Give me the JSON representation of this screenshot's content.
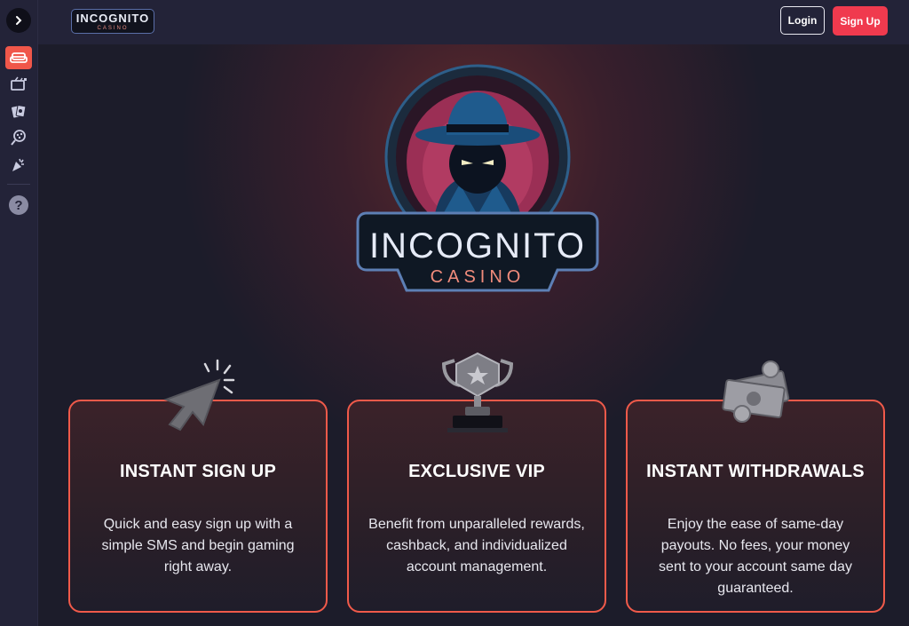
{
  "brand": {
    "logo_word": "INCOGNITO",
    "logo_sub": "CASINO",
    "hero_word": "INCOGNITO",
    "hero_sub": "CASINO"
  },
  "header": {
    "login_label": "Login",
    "signup_label": "Sign Up"
  },
  "sidebar": {
    "toggle_icon": "chevron-right-icon",
    "items": [
      {
        "icon": "sofa-icon",
        "active": true
      },
      {
        "icon": "tv-icon",
        "active": false
      },
      {
        "icon": "cards-icon",
        "active": false
      },
      {
        "icon": "lottery-ball-icon",
        "active": false
      },
      {
        "icon": "party-popper-icon",
        "active": false
      }
    ],
    "help_label": "?"
  },
  "features": [
    {
      "icon": "cursor-click-icon",
      "title": "INSTANT SIGN UP",
      "text": "Quick and easy sign up with a simple SMS and begin gaming right away."
    },
    {
      "icon": "trophy-icon",
      "title": "EXCLUSIVE VIP",
      "text": "Benefit from unparalleled rewards, cashback, and individualized account management."
    },
    {
      "icon": "money-icon",
      "title": "INSTANT WITHDRAWALS",
      "text": "Enjoy the ease of same-day payouts. No fees, your money sent to your account same day guaranteed."
    }
  ],
  "colors": {
    "accent": "#f03a4e",
    "card_border": "#f05a4a",
    "sidebar_active": "#f0574a",
    "background": "#1b1b2a"
  }
}
